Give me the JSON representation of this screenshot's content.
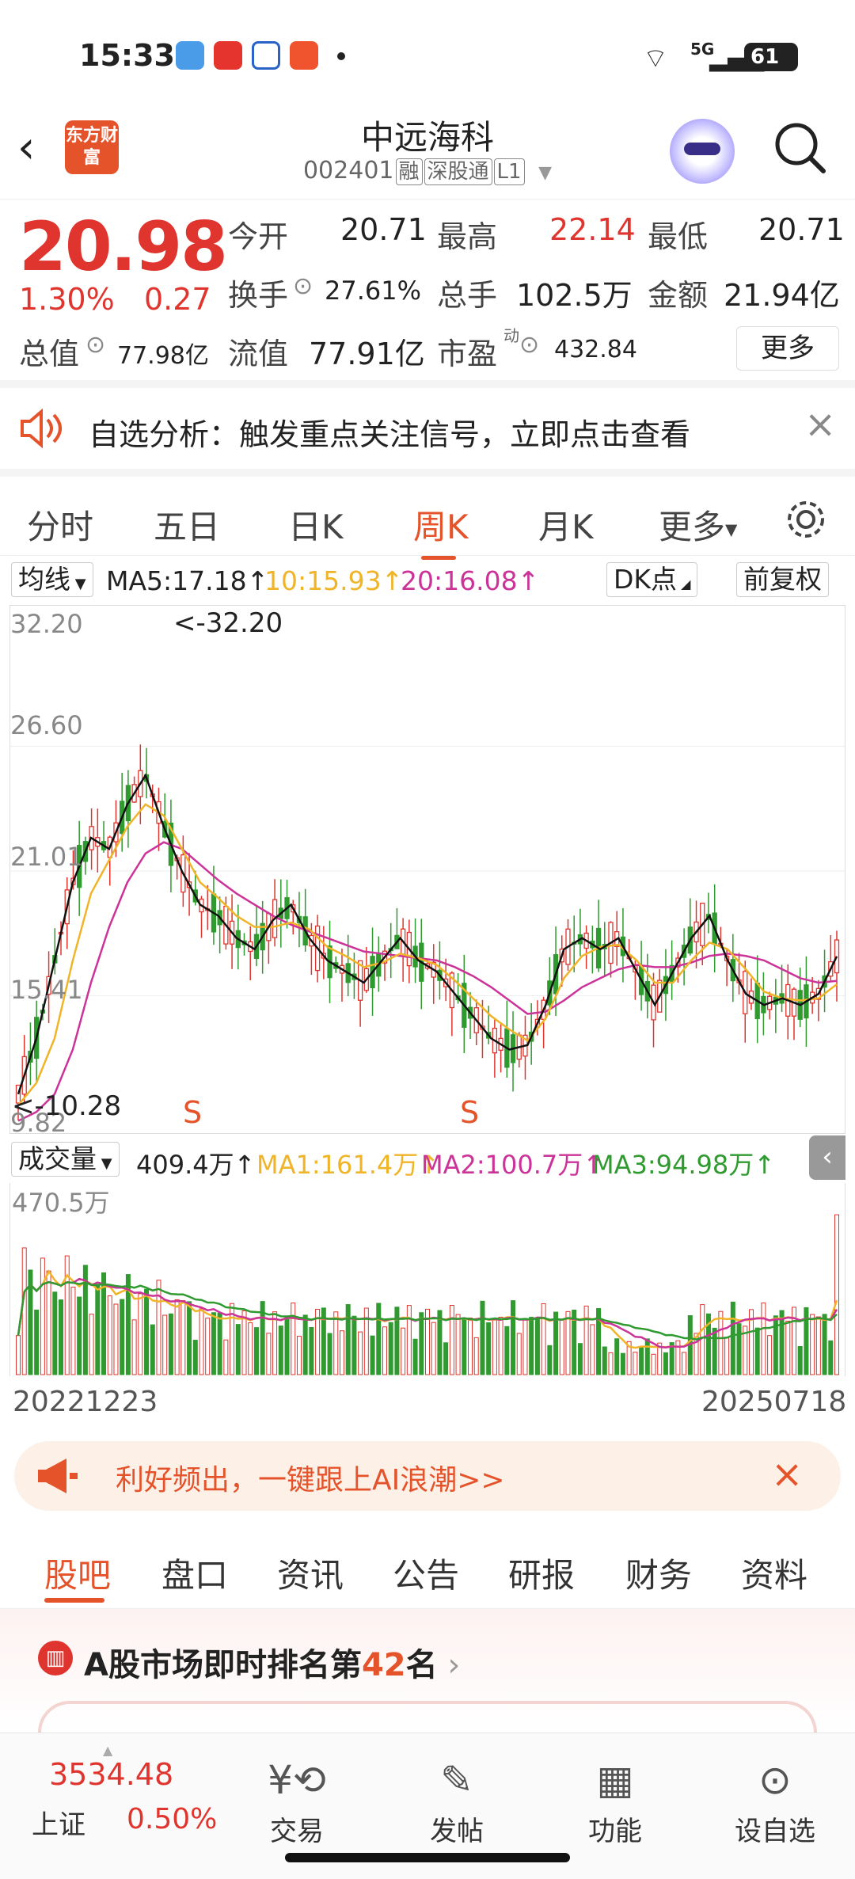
{
  "status_bar": {
    "time": "15:33",
    "network": "5G",
    "battery": "61"
  },
  "header": {
    "logo_text": "东方财富",
    "stock_name": "中远海科",
    "stock_code": "002401",
    "tags": [
      "融",
      "深股通",
      "L1"
    ]
  },
  "quote": {
    "price": "20.98",
    "change_pct": "1.30%",
    "change_amt": "0.27",
    "open_label": "今开",
    "open": "20.71",
    "high_label": "最高",
    "high": "22.14",
    "low_label": "最低",
    "low": "20.71",
    "turnover_label": "换手",
    "turnover": "27.61%",
    "volume_label": "总手",
    "volume": "102.5万",
    "amount_label": "金额",
    "amount": "21.94亿",
    "total_cap_label": "总值",
    "total_cap": "77.98亿",
    "float_cap_label": "流值",
    "float_cap": "77.91亿",
    "pe_label": "市盈",
    "pe_sup": "动",
    "pe": "432.84",
    "more_button": "更多"
  },
  "alert": {
    "text": "自选分析：触发重点关注信号，立即点击查看"
  },
  "chart_tabs": [
    "分时",
    "五日",
    "日K",
    "周K",
    "月K",
    "更多"
  ],
  "ma_row": {
    "selector": "均线",
    "ma5": "MA5:17.18",
    "ma10": "10:15.93",
    "ma20": "20:16.08",
    "dk": "DK点",
    "adjust": "前复权"
  },
  "kchart": {
    "y_labels": [
      "32.20",
      "26.60",
      "21.01",
      "15.41",
      "9.82"
    ],
    "max_label": "<-32.20",
    "min_label": "<-10.28",
    "signal_s": "S",
    "watermark": "东方财富"
  },
  "vol_row": {
    "selector": "成交量",
    "vol": "409.4万",
    "ma1": "MA1:161.4万",
    "ma2": "MA2:100.7万",
    "ma3": "MA3:94.98万"
  },
  "vchart": {
    "max_label": "470.5万"
  },
  "dates": {
    "start": "20221223",
    "end": "20250718"
  },
  "promo": {
    "text": "利好频出，一键跟上AI浪潮>>"
  },
  "bottom_tabs": [
    "股吧",
    "盘口",
    "资讯",
    "公告",
    "研报",
    "财务",
    "资料"
  ],
  "rank": {
    "prefix": "A股市场即时排名第",
    "number": "42",
    "suffix": "名"
  },
  "nav": {
    "index_value": "3534.48",
    "index_name": "上证",
    "index_change": "0.50%",
    "items": [
      "交易",
      "发帖",
      "功能",
      "设自选"
    ]
  },
  "colors": {
    "up": "#e0342e",
    "down": "#2f9a2f",
    "accent": "#e5532b",
    "ma5": "#111111",
    "ma10": "#f0b428",
    "ma20": "#cc3399"
  },
  "chart_data": {
    "type": "candlestick",
    "title": "",
    "price_range": [
      9.82,
      32.2
    ],
    "volume_range": [
      0,
      470.5
    ],
    "volume_unit": "万",
    "ma5_trend": [
      11.0,
      13.5,
      17.0,
      20.5,
      22.5,
      22.0,
      24.0,
      25.3,
      23.0,
      21.0,
      19.5,
      19.0,
      18.0,
      17.5,
      18.8,
      19.5,
      18.0,
      17.0,
      16.5,
      16.0,
      17.0,
      18.0,
      17.0,
      16.5,
      15.5,
      14.5,
      13.5,
      13.0,
      13.2,
      15.0,
      17.5,
      18.0,
      17.5,
      18.0,
      16.5,
      15.0,
      16.5,
      18.0,
      19.0,
      17.0,
      15.5,
      15.0,
      15.3,
      15.0,
      15.5,
      17.18
    ],
    "ma10_trend": [
      10.5,
      11.5,
      13.5,
      17.0,
      20.0,
      21.5,
      23.0,
      24.0,
      23.5,
      22.0,
      20.5,
      19.8,
      19.0,
      18.5,
      18.5,
      18.7,
      18.4,
      17.6,
      17.2,
      16.7,
      16.9,
      17.3,
      17.1,
      16.8,
      16.1,
      15.3,
      14.5,
      13.9,
      13.4,
      14.4,
      16.2,
      17.2,
      17.6,
      17.7,
      17.0,
      16.0,
      16.0,
      17.0,
      17.8,
      17.5,
      16.6,
      15.6,
      15.3,
      15.2,
      15.3,
      15.93
    ],
    "ma20_trend": [
      9.8,
      10.2,
      11.0,
      13.0,
      16.0,
      18.5,
      20.5,
      21.8,
      22.3,
      22.0,
      21.3,
      20.6,
      20.0,
      19.5,
      19.0,
      18.6,
      18.3,
      18.0,
      17.7,
      17.4,
      17.3,
      17.2,
      17.1,
      17.0,
      16.7,
      16.3,
      15.8,
      15.2,
      14.6,
      14.7,
      15.2,
      15.8,
      16.2,
      16.6,
      16.8,
      16.7,
      16.7,
      16.9,
      17.2,
      17.3,
      17.2,
      17.0,
      16.6,
      16.2,
      16.0,
      16.08
    ],
    "volume_ma1_latest": 161.4,
    "volume_ma2_latest": 100.7,
    "volume_ma3_latest": 94.98,
    "volume_latest": 409.4
  }
}
